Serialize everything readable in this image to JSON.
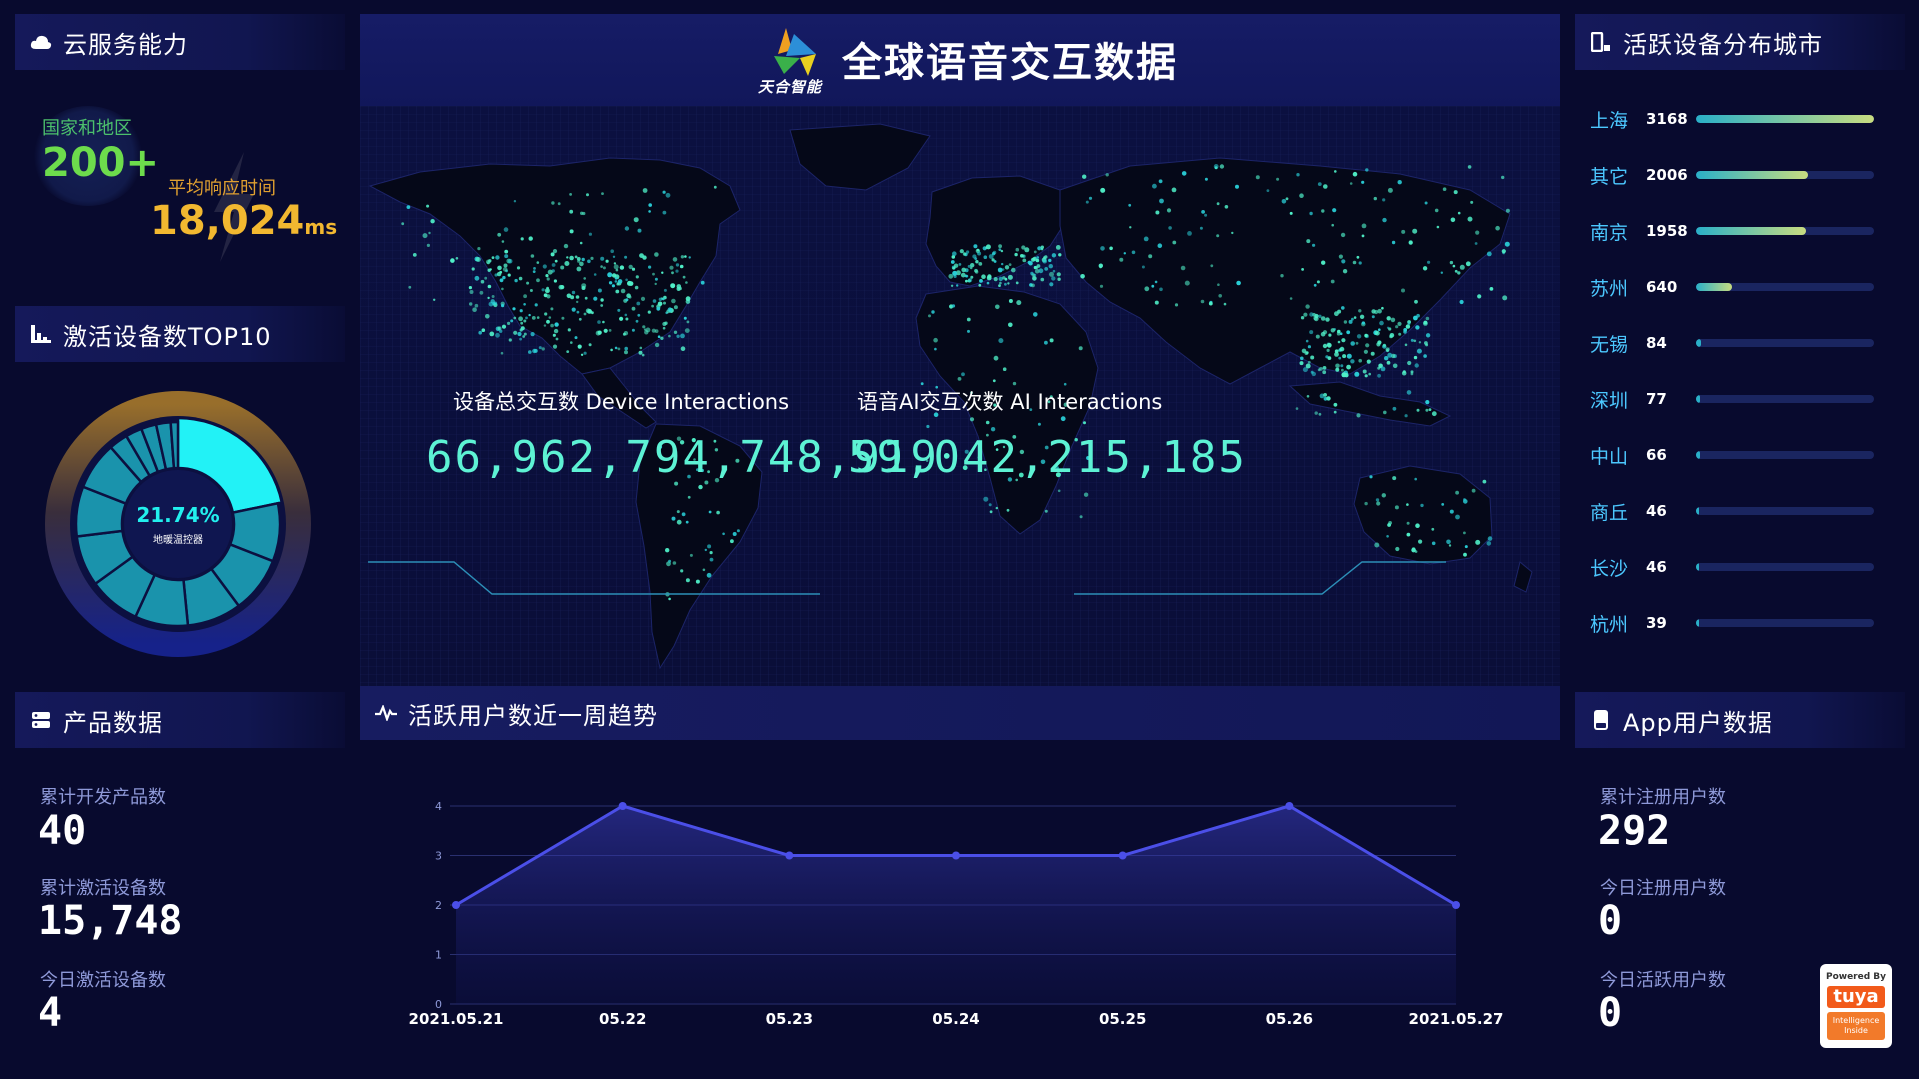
{
  "header": {
    "title": "全球语音交互数据",
    "logo_text": "天合智能"
  },
  "cloud": {
    "heading": "云服务能力",
    "regions_label": "国家和地区",
    "regions_value": "200+",
    "response_label": "平均响应时间",
    "response_value": "18,024",
    "response_unit": "ms"
  },
  "top10": {
    "heading": "激活设备数TOP10",
    "donut_percent": "21.74%",
    "donut_label": "地暖温控器",
    "segments": [
      21.74,
      9.2,
      8.9,
      8.6,
      8.4,
      8.2,
      8.0,
      7.9,
      7.6,
      3.0,
      2.6,
      2.4,
      2.3,
      1.15
    ]
  },
  "map": {
    "device_label": "设备总交互数 Device Interactions",
    "device_value": "66,962,794,748,919",
    "ai_label": "语音AI交互次数 AI Interactions",
    "ai_value": "59,042,215,185"
  },
  "cities": {
    "heading": "活跃设备分布城市",
    "items": [
      {
        "name": "上海",
        "value": "3168",
        "ratio": 1.0
      },
      {
        "name": "其它",
        "value": "2006",
        "ratio": 0.63
      },
      {
        "name": "南京",
        "value": "1958",
        "ratio": 0.62
      },
      {
        "name": "苏州",
        "value": "640",
        "ratio": 0.2
      },
      {
        "name": "无锡",
        "value": "84",
        "ratio": 0.026
      },
      {
        "name": "深圳",
        "value": "77",
        "ratio": 0.024
      },
      {
        "name": "中山",
        "value": "66",
        "ratio": 0.021
      },
      {
        "name": "商丘",
        "value": "46",
        "ratio": 0.015
      },
      {
        "name": "长沙",
        "value": "46",
        "ratio": 0.015
      },
      {
        "name": "杭州",
        "value": "39",
        "ratio": 0.012
      }
    ]
  },
  "products": {
    "heading": "产品数据",
    "items": [
      {
        "label": "累计开发产品数",
        "value": "40"
      },
      {
        "label": "累计激活设备数",
        "value": "15,748"
      },
      {
        "label": "今日激活设备数",
        "value": "4"
      }
    ]
  },
  "trend": {
    "heading": "活跃用户数近一周趋势"
  },
  "app_users": {
    "heading": "App用户数据",
    "items": [
      {
        "label": "累计注册用户数",
        "value": "292"
      },
      {
        "label": "今日注册用户数",
        "value": "0"
      },
      {
        "label": "今日活跃用户数",
        "value": "0"
      }
    ]
  },
  "badge": {
    "powered": "Powered By",
    "brand": "tuya",
    "sub1": "Intelligence",
    "sub2": "Inside"
  },
  "chart_data": {
    "type": "area",
    "categories": [
      "2021.05.21",
      "05.22",
      "05.23",
      "05.24",
      "05.25",
      "05.26",
      "2021.05.27"
    ],
    "values": [
      2,
      4,
      3,
      3,
      3,
      4,
      2
    ],
    "ylim": [
      0,
      4
    ],
    "yticks": [
      "0",
      "1",
      "2",
      "3",
      "4"
    ],
    "grid": true,
    "title": "",
    "xlabel": "",
    "ylabel": "",
    "line_color": "#4b4fe8"
  }
}
